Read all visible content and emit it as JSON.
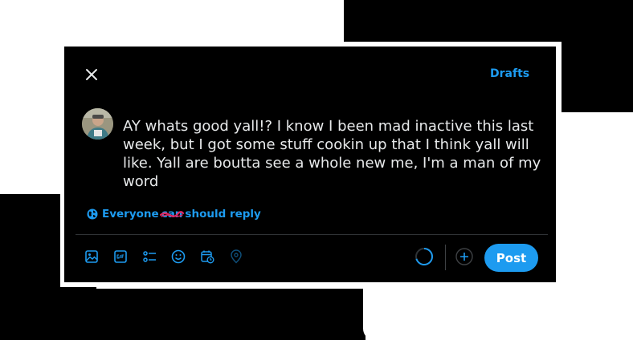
{
  "header": {
    "close_label": "close",
    "drafts_label": "Drafts"
  },
  "composer": {
    "text": "AY whats good yall!? I know I been mad inactive this last week, but I got some stuff cookin up that I think yall will like. Yall are boutta see a whole new me, I'm a man of my word"
  },
  "reply_setting": {
    "prefix": "Everyone",
    "struck_word": "can",
    "suffix": "should reply"
  },
  "toolbar": {
    "icons": [
      "image-icon",
      "gif-icon",
      "poll-icon",
      "emoji-icon",
      "schedule-icon",
      "location-icon"
    ]
  },
  "actions": {
    "post_label": "Post"
  },
  "colors": {
    "accent": "#1d9bf0",
    "background": "#000000",
    "text": "#e7e9ea",
    "strike": "#e0245e"
  }
}
